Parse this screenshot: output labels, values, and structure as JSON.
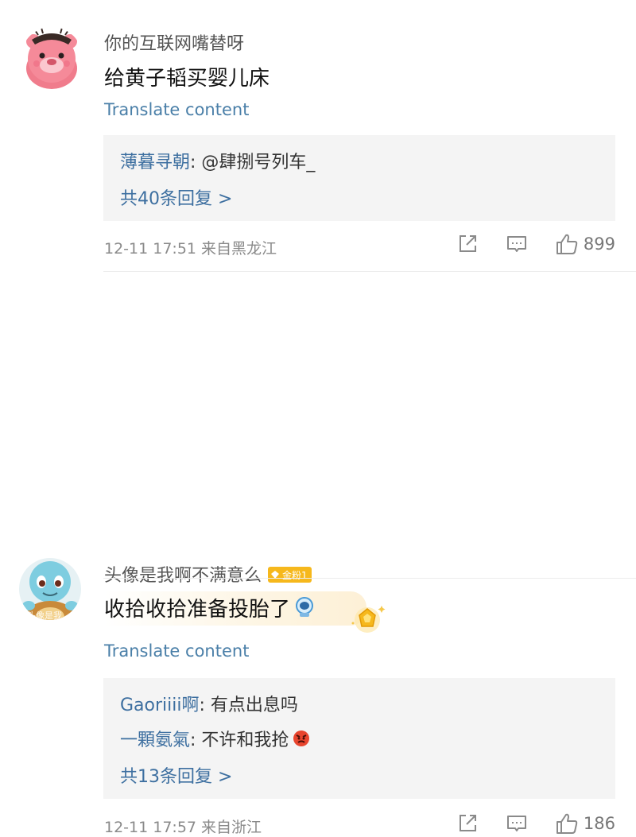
{
  "comments": [
    {
      "username": "你的互联网嘴替呀",
      "content": "给黄子韬买婴儿床",
      "translate_label": "Translate content",
      "replies": [
        {
          "name": "薄暮寻朝",
          "text": ": @肆捌号列车_"
        }
      ],
      "more_replies": "共40条回复 >",
      "meta": "12-11 17:51 来自黑龙江",
      "likes": "899"
    },
    {
      "username": "头像是我啊不满意么",
      "badge": "金粉1",
      "content": "收拾收拾准备投胎了",
      "translate_label": "Translate content",
      "avatar_text": "头像是我",
      "replies": [
        {
          "name": "Gaoriiii啊",
          "text": ": 有点出息吗"
        },
        {
          "name": "一顆氨氣",
          "text": ": 不许和我抢"
        }
      ],
      "more_replies": "共13条回复 >",
      "meta": "12-11 17:57 来自浙江",
      "likes": "186"
    }
  ],
  "icons": {
    "share": "share-icon",
    "comment": "comment-icon",
    "like": "thumbs-up-icon"
  },
  "colors": {
    "link": "#3d6fa0",
    "translate": "#4a7fa8",
    "badge": "#f6b81c",
    "reply_bg": "#f4f4f4"
  }
}
